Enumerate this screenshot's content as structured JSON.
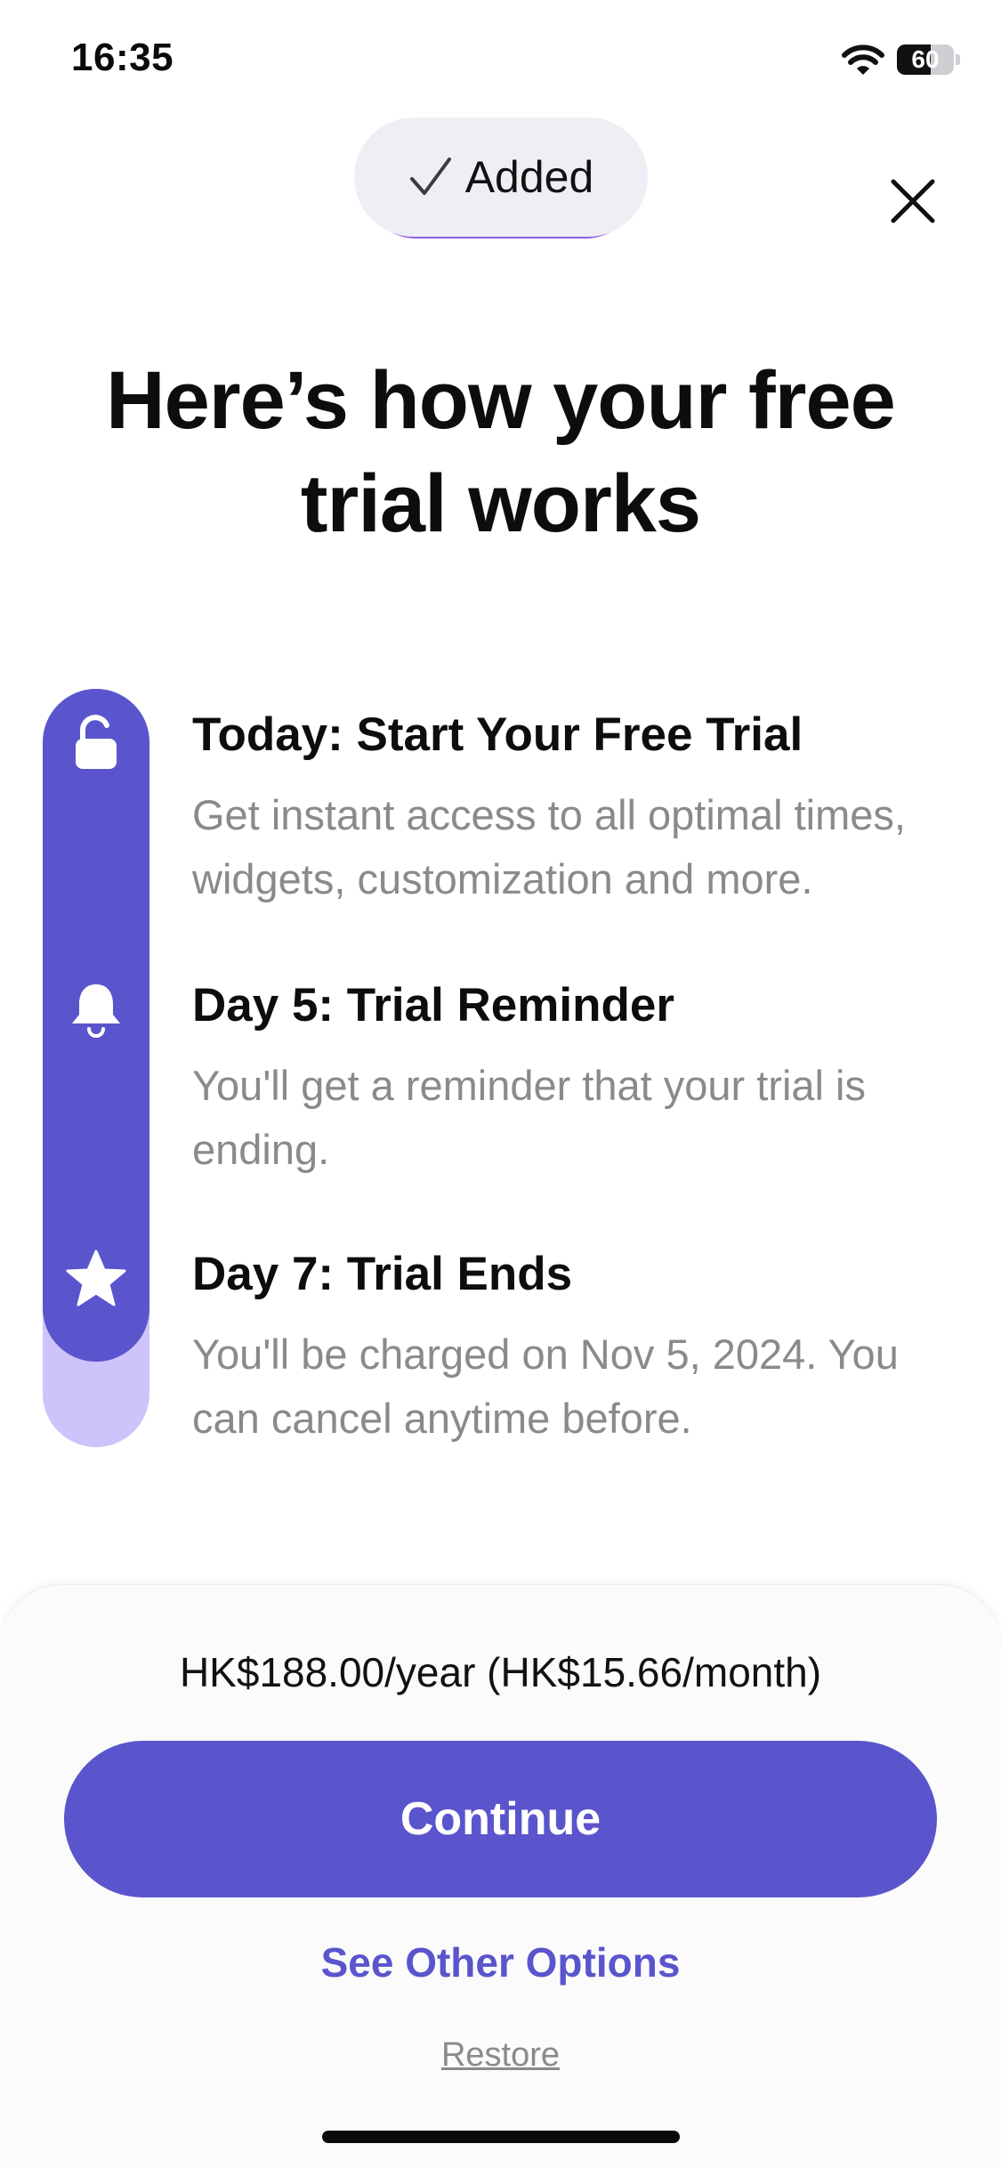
{
  "status_bar": {
    "time": "16:35",
    "battery_level": "60",
    "battery_fraction": 0.6,
    "icons": [
      "wifi-icon",
      "battery-icon"
    ]
  },
  "badge": {
    "label": "Added",
    "icon": "checkmark-icon"
  },
  "close": {
    "icon": "close-icon"
  },
  "headline": "Here’s how your free trial works",
  "steps": [
    {
      "icon": "unlock-icon",
      "title": "Today: Start Your Free Trial",
      "description": "Get instant access to all optimal times, widgets, customization and more."
    },
    {
      "icon": "bell-icon",
      "title": "Day 5: Trial Reminder",
      "description": "You'll get a reminder that your trial is ending."
    },
    {
      "icon": "star-icon",
      "title": "Day 7: Trial Ends",
      "description": "You'll be charged on Nov 5, 2024. You can cancel anytime before."
    }
  ],
  "footer": {
    "price": "HK$188.00/year (HK$15.66/month)",
    "continue_label": "Continue",
    "other_options_label": "See Other Options",
    "restore_label": "Restore"
  },
  "colors": {
    "accent": "#5A55CC",
    "timeline_light": "#CFC3FB",
    "badge_underline": "#8E5BE0",
    "secondary_text": "#8A8A8E"
  }
}
